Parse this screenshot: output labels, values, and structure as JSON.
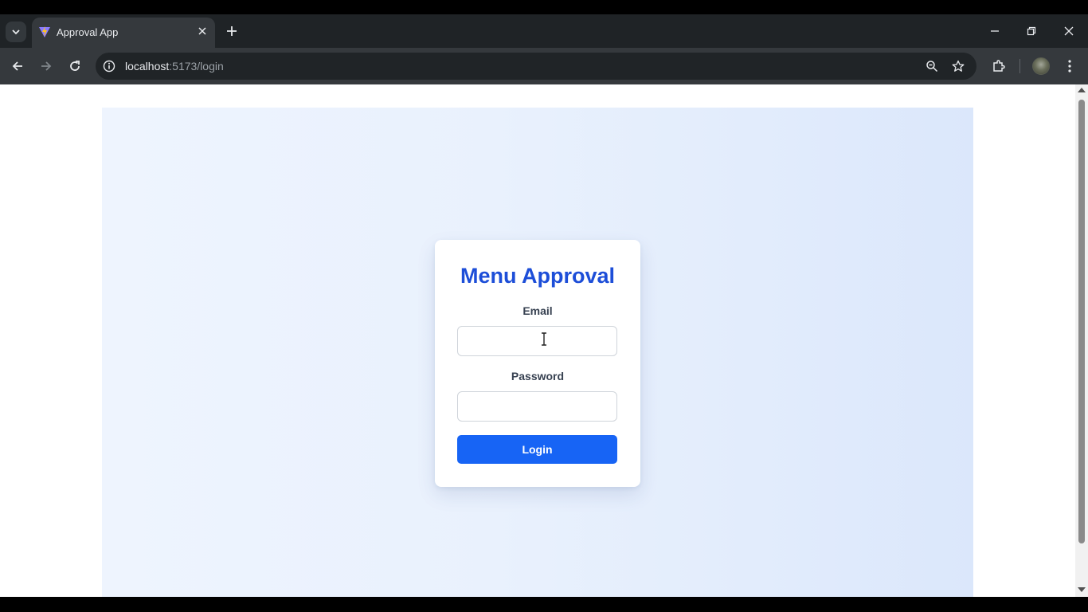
{
  "browser": {
    "tab": {
      "title": "Approval App"
    },
    "address": {
      "host": "localhost",
      "path": ":5173/login"
    }
  },
  "login": {
    "title": "Menu Approval",
    "email_label": "Email",
    "email_value": "",
    "password_label": "Password",
    "password_value": "",
    "submit_label": "Login"
  },
  "colors": {
    "accent": "#1764f5",
    "title": "#1d4ed8",
    "background": "#e6effc"
  }
}
